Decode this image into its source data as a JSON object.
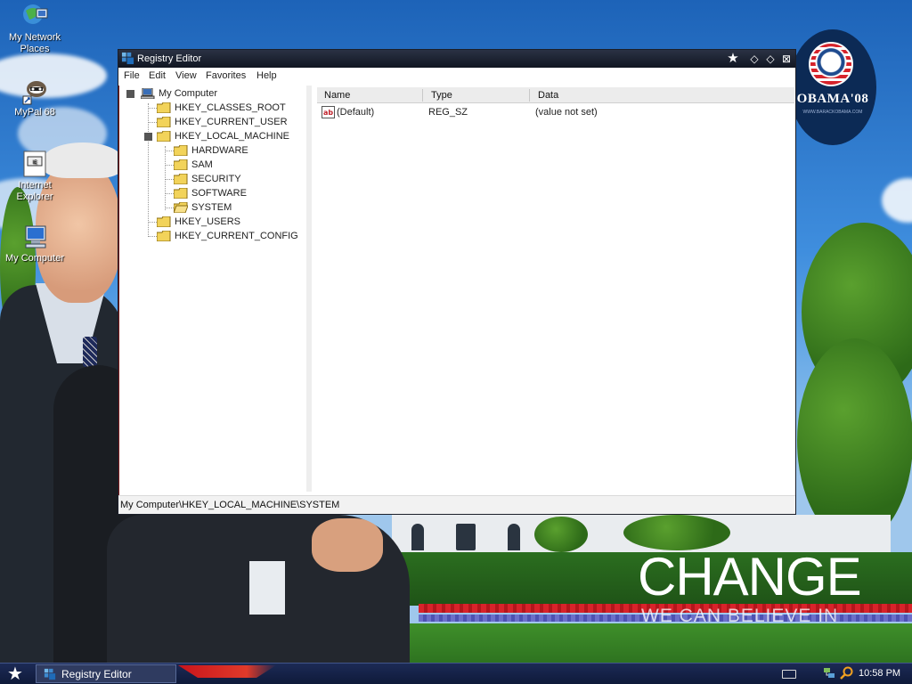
{
  "desktop": {
    "icons": [
      {
        "label": "My Network Places"
      },
      {
        "label": "MyPal 68"
      },
      {
        "label": "Internet Explorer"
      },
      {
        "label": "My Computer"
      }
    ],
    "wallpaper": {
      "logo_text": "OBAMA'08",
      "logo_small": "WWW.BARACKOBAMA.COM",
      "headline": "CHANGE",
      "subline": "WE CAN BELIEVE IN"
    }
  },
  "window": {
    "title": "Registry Editor",
    "menu": [
      "File",
      "Edit",
      "View",
      "Favorites",
      "Help"
    ],
    "tree": {
      "root": "My Computer",
      "hives": [
        {
          "label": "HKEY_CLASSES_ROOT"
        },
        {
          "label": "HKEY_CURRENT_USER"
        },
        {
          "label": "HKEY_LOCAL_MACHINE"
        },
        {
          "label": "HKEY_USERS"
        },
        {
          "label": "HKEY_CURRENT_CONFIG"
        }
      ],
      "hklm_children": [
        {
          "label": "HARDWARE"
        },
        {
          "label": "SAM"
        },
        {
          "label": "SECURITY"
        },
        {
          "label": "SOFTWARE"
        },
        {
          "label": "SYSTEM"
        }
      ]
    },
    "list": {
      "columns": [
        "Name",
        "Type",
        "Data"
      ],
      "rows": [
        {
          "name": "(Default)",
          "type": "REG_SZ",
          "data": "(value not set)"
        }
      ]
    },
    "status_path": "My Computer\\HKEY_LOCAL_MACHINE\\SYSTEM"
  },
  "taskbar": {
    "task_label": "Registry Editor",
    "clock": "10:58 PM"
  },
  "colors": {
    "titlebar": "#1a2032",
    "taskbar": "#15234a",
    "folder": "#f2d35a"
  }
}
